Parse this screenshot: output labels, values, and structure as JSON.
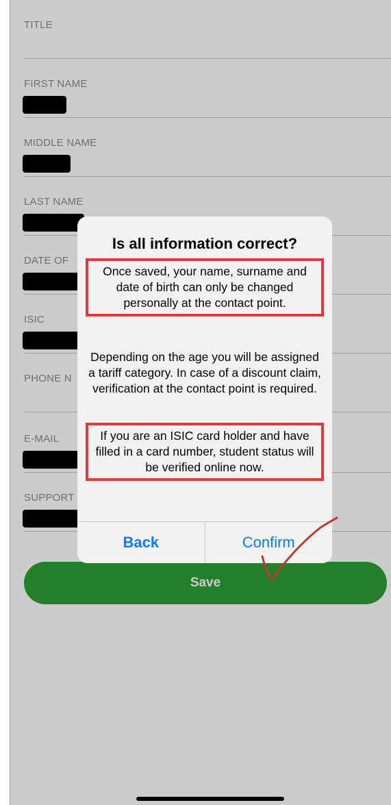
{
  "form": {
    "fields": [
      {
        "label": "TITLE"
      },
      {
        "label": "FIRST NAME"
      },
      {
        "label": "MIDDLE NAME"
      },
      {
        "label": "LAST NAME"
      },
      {
        "label": "DATE OF"
      },
      {
        "label": "ISIC"
      },
      {
        "label": "PHONE N"
      },
      {
        "label": "E-MAIL"
      },
      {
        "label": "SUPPORT"
      }
    ],
    "save_label": "Save"
  },
  "dialog": {
    "title": "Is all information correct?",
    "message1": "Once saved, your name, surname and date of birth can only be changed personally at the contact point.",
    "message2": "Depending on the age you will be assigned a tariff category. In case of a discount claim, verification at the contact point is required.",
    "message3": "If you are an ISIC card holder and have filled in a card number, student status will be verified online now.",
    "back_label": "Back",
    "confirm_label": "Confirm"
  },
  "colors": {
    "save_green": "#2ca135",
    "ios_blue": "#0a7aff",
    "highlight_red": "#e8363f",
    "checkmark_red": "#c0392b"
  },
  "icons": {
    "annotation": "checkmark-annotation"
  }
}
